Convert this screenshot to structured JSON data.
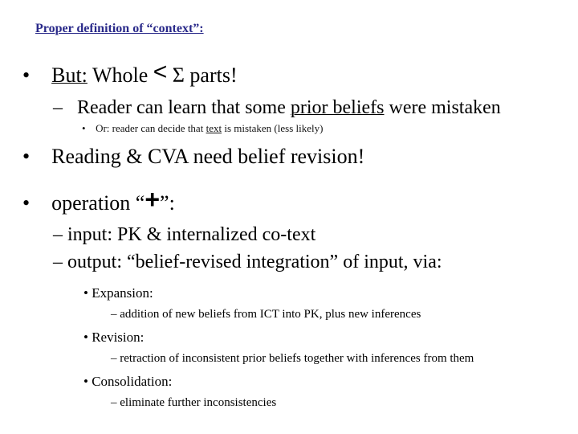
{
  "slide": {
    "title": "Proper definition of “context”:",
    "title_color": "#2a2a8a",
    "bullet_glyph": "•",
    "dash_glyph": "–",
    "items": {
      "but": {
        "label": "But:",
        "text_before": "Whole",
        "lt_symbol": "<",
        "text_after": "Σ parts!"
      },
      "reader": {
        "prefix": "Reader can learn that some",
        "underlined": "prior beliefs",
        "suffix": "were mistaken"
      },
      "or": {
        "prefix": "Or:  reader can decide that",
        "underlined": "text",
        "suffix": "is mistaken (less likely)"
      },
      "reading": "Reading & CVA need belief revision!",
      "operation": {
        "prefix": "operation “",
        "symbol": "+",
        "suffix": "”:"
      },
      "input": "input:  PK & internalized co-text",
      "output": "output: “belief-revised integration” of input, via:",
      "expansion": {
        "label": "Expansion:",
        "detail": "addition of new beliefs from ICT into PK, plus new inferences"
      },
      "revision": {
        "label": "Revision:",
        "detail": "retraction of inconsistent prior beliefs together with inferences from them"
      },
      "consolidation": {
        "label": "Consolidation:",
        "detail": "eliminate further inconsistencies"
      }
    }
  }
}
